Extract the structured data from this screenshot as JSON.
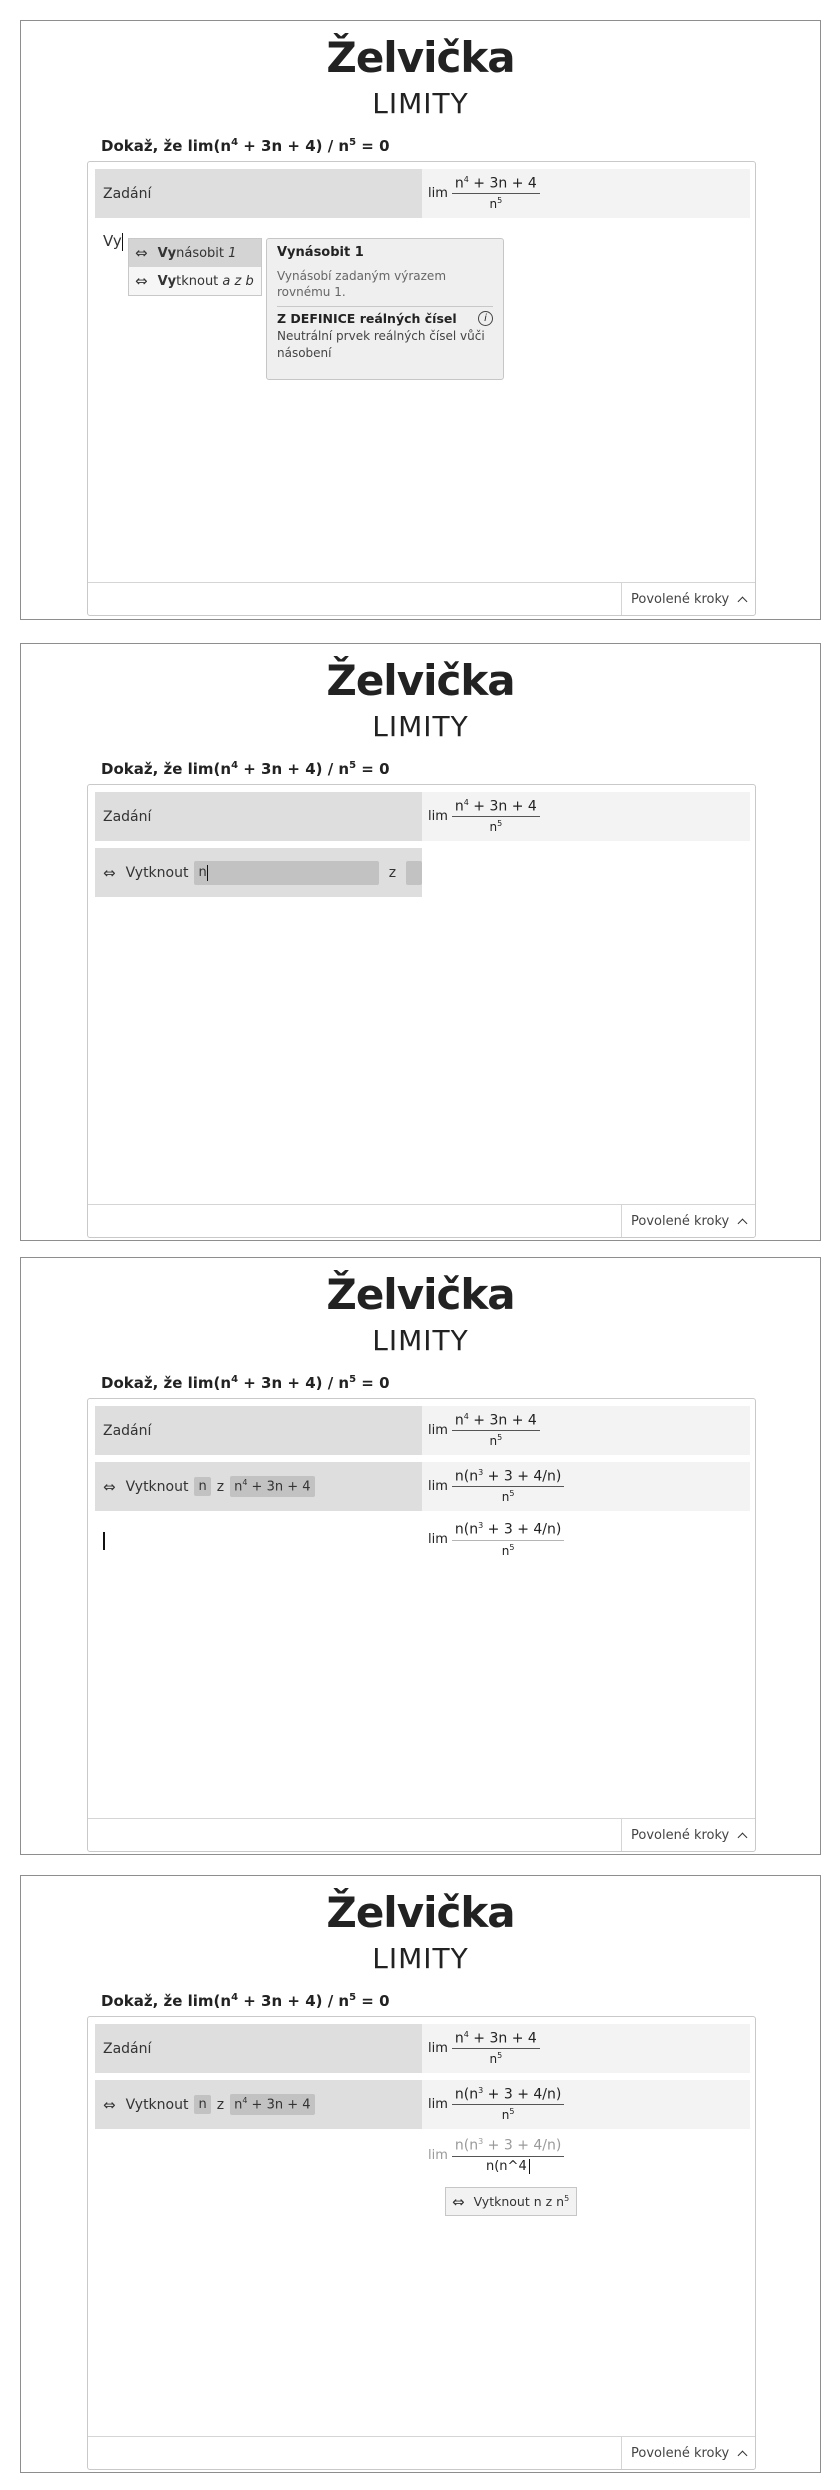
{
  "app": {
    "title": "Želvička",
    "subtitle": "LIMITY"
  },
  "problem": {
    "prefix": "Dokaž, že lim(n",
    "exp1": "4",
    "mid": " + 3n + 4) / n",
    "exp2": "5",
    "suffix": " = 0"
  },
  "footer": {
    "allowed_steps": "Povolené kroky"
  },
  "given": {
    "label": "Zadání",
    "lim": "lim",
    "num_base": "n",
    "num_exp": "4",
    "num_rest": " + 3n + 4",
    "den_base": "n",
    "den_exp": "5"
  },
  "step_label": "Vytknout",
  "step_between": "z",
  "factor_value": "n",
  "expr_value": {
    "base": "n",
    "exp": "4",
    "rest": " + 3n + 4"
  },
  "result": {
    "num": "n(n",
    "num_exp": "3",
    "num_rest": " + 3 + 4/n)",
    "den_base": "n",
    "den_exp": "5"
  },
  "panel1": {
    "typed": "Vy",
    "autocomplete": [
      {
        "bold": "Vy",
        "rest": "násobit",
        "arg": "1"
      },
      {
        "bold": "Vy",
        "rest": "tknout",
        "arg": "a z b"
      }
    ],
    "tooltip": {
      "title": "Vynásobit 1",
      "desc": "Vynásobí zadaným výrazem rovnému 1.",
      "def_title": "Z DEFINICE reálných čísel",
      "info": "i",
      "def_text": "Neutrální prvek reálných čísel vůči násobení"
    }
  },
  "panel4": {
    "den_typed": "n(n^4",
    "suggestion": {
      "prefix": "Vytknout n z n",
      "exp": "5"
    }
  },
  "icons": {
    "step_arrow": "⇔"
  }
}
